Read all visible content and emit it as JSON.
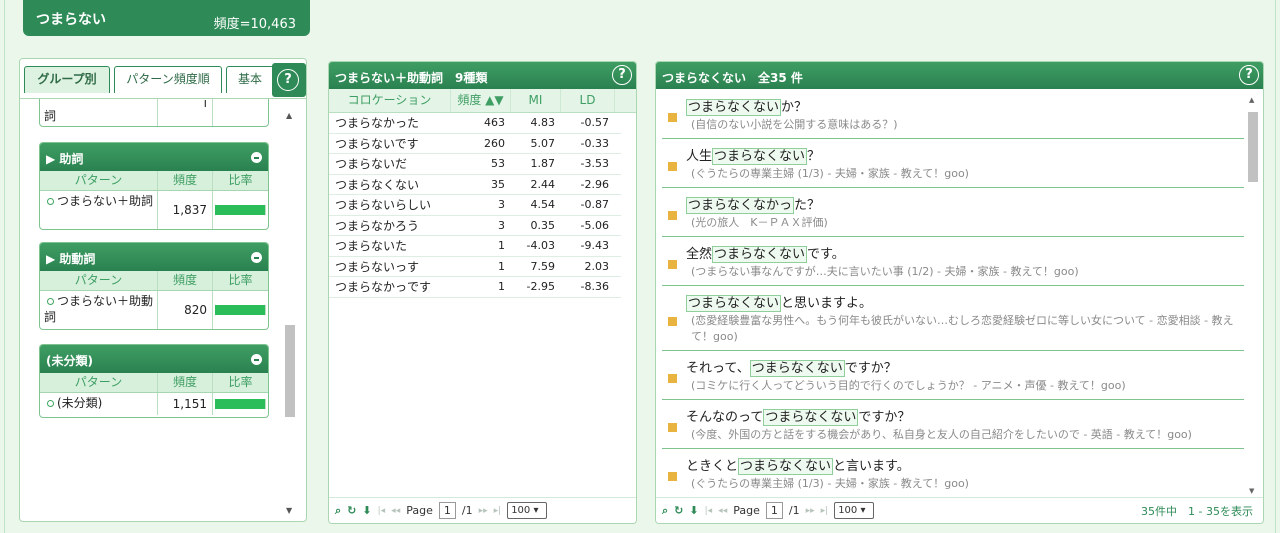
{
  "word": {
    "label": "つまらない",
    "freq": "頻度=10,463"
  },
  "left": {
    "tabs": [
      "グループ別",
      "パターン頻度順",
      "基本"
    ],
    "help": "?",
    "partial_row": {
      "pattern": "詞",
      "freq": "",
      "ratio": ""
    },
    "groups": [
      {
        "title": "▶ 助詞",
        "headers": [
          "パターン",
          "頻度",
          "比率"
        ],
        "pattern": "つまらない＋助詞",
        "freq": "1,837",
        "ratio": 1.0
      },
      {
        "title": "▶ 助動詞",
        "headers": [
          "パターン",
          "頻度",
          "比率"
        ],
        "pattern": "つまらない＋助動詞",
        "freq": "820",
        "ratio": 1.0
      },
      {
        "title": "(未分類)",
        "headers": [
          "パターン",
          "頻度",
          "比率"
        ],
        "pattern": "(未分類)",
        "freq": "1,151",
        "ratio": 1.0
      }
    ]
  },
  "middle": {
    "title": "つまらない＋助動詞　9種類",
    "help": "?",
    "headers": [
      "コロケーション",
      "頻度 ▲▼",
      "MI",
      "LD"
    ],
    "rows": [
      [
        "つまらなかった",
        "463",
        "4.83",
        "-0.57"
      ],
      [
        "つまらないです",
        "260",
        "5.07",
        "-0.33"
      ],
      [
        "つまらないだ",
        "53",
        "1.87",
        "-3.53"
      ],
      [
        "つまらなくない",
        "35",
        "2.44",
        "-2.96"
      ],
      [
        "つまらないらしい",
        "3",
        "4.54",
        "-0.87"
      ],
      [
        "つまらなかろう",
        "3",
        "0.35",
        "-5.06"
      ],
      [
        "つまらないた",
        "1",
        "-4.03",
        "-9.43"
      ],
      [
        "つまらないっす",
        "1",
        "7.59",
        "2.03"
      ],
      [
        "つまらなかっです",
        "1",
        "-2.95",
        "-8.36"
      ]
    ],
    "pager": {
      "page_label": "Page",
      "page": "1",
      "of": "/1",
      "per_page": "100"
    }
  },
  "right": {
    "title": "つまらなくない　全35 件",
    "help": "?",
    "items": [
      {
        "pre": "",
        "kw": "つまらなくない",
        "post": "か？",
        "src": "(自信のない小説を公開する意味はある？)"
      },
      {
        "pre": "人生",
        "kw": "つまらなくない",
        "post": "？",
        "src": "(ぐうたらの専業主婦 (1/3) - 夫婦・家族 - 教えて！goo)"
      },
      {
        "pre": "",
        "kw": "つまらなくなかっ",
        "post": "た？",
        "src": "(光の旅人　K－ＰＡＸ評価)"
      },
      {
        "pre": "全然",
        "kw": "つまらなくない",
        "post": "です。",
        "src": "(つまらない事なんですが…夫に言いたい事 (1/2) - 夫婦・家族 - 教えて！goo)"
      },
      {
        "pre": "",
        "kw": "つまらなくない",
        "post": "と思いますよ。",
        "src": "(恋愛経験豊富な男性へ。もう何年も彼氏がいない…むしろ恋愛経験ゼロに等しい女について - 恋愛相談 - 教えて！goo)"
      },
      {
        "pre": "それって、",
        "kw": "つまらなくない",
        "post": "ですか？",
        "src": "(コミケに行く人ってどういう目的で行くのでしょうか？ - アニメ・声優 - 教えて！goo)"
      },
      {
        "pre": "そんなのって",
        "kw": "つまらなくない",
        "post": "ですか？",
        "src": "(今度、外国の方と話をする機会があり、私自身と友人の自己紹介をしたいので - 英語 - 教えて！goo)"
      },
      {
        "pre": "ときくと",
        "kw": "つまらなくない",
        "post": "と言います。",
        "src": "(ぐうたらの専業主婦 (1/3) - 夫婦・家族 - 教えて！goo)"
      }
    ],
    "pager": {
      "page_label": "Page",
      "page": "1",
      "of": "/1",
      "per_page": "100",
      "status": "35件中　1 - 35を表示"
    }
  }
}
